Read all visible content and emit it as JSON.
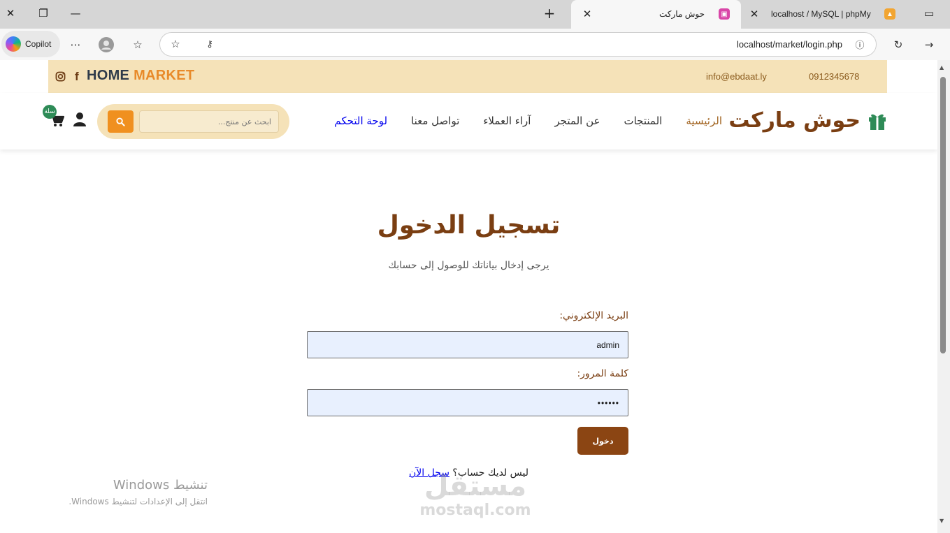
{
  "browser": {
    "tabs": [
      {
        "title": "حوش ماركت",
        "active": true
      },
      {
        "title": "localhost / MySQL | phpMy",
        "active": false
      }
    ],
    "copilot_label": "Copilot",
    "url": "localhost/market/login.php"
  },
  "topbar": {
    "brand_primary": "HOME",
    "brand_accent": "MARKET",
    "email": "info@ebdaat.ly",
    "phone": "0912345678"
  },
  "navbar": {
    "logo": "حوش ماركت",
    "links": [
      "الرئيسية",
      "المنتجات",
      "عن المتجر",
      "آراء العملاء",
      "تواصل معنا",
      "لوحة التحكم"
    ],
    "search_placeholder": "ابحث عن منتج...",
    "cart_badge": "سلة"
  },
  "login": {
    "title": "تسجيل الدخول",
    "subtitle": "يرجى إدخال بياناتك للوصول إلى حسابك",
    "email_label": "البريد الإلكتروني:",
    "email_value": "admin",
    "password_label": "كلمة المرور:",
    "password_value": "••••••",
    "submit_label": "دخول",
    "no_account_text": "ليس لديك حساب؟",
    "register_link": "سجل الآن"
  },
  "os_overlay": {
    "activation_title": "تنشيط Windows",
    "activation_subtitle": "انتقل إلى الإعدادات لتنشيط Windows."
  },
  "watermark": {
    "arabic": "مستقل",
    "latin": "mostaql.com"
  },
  "colors": {
    "brand_brown": "#7a3e12",
    "topbar_bg": "#f5e2b8",
    "search_button": "#f0901f",
    "field_bg": "#e8f0fe",
    "submit_bg": "#8b4513",
    "badge_green": "#2e8b57",
    "gift_green": "#2e8b57"
  }
}
